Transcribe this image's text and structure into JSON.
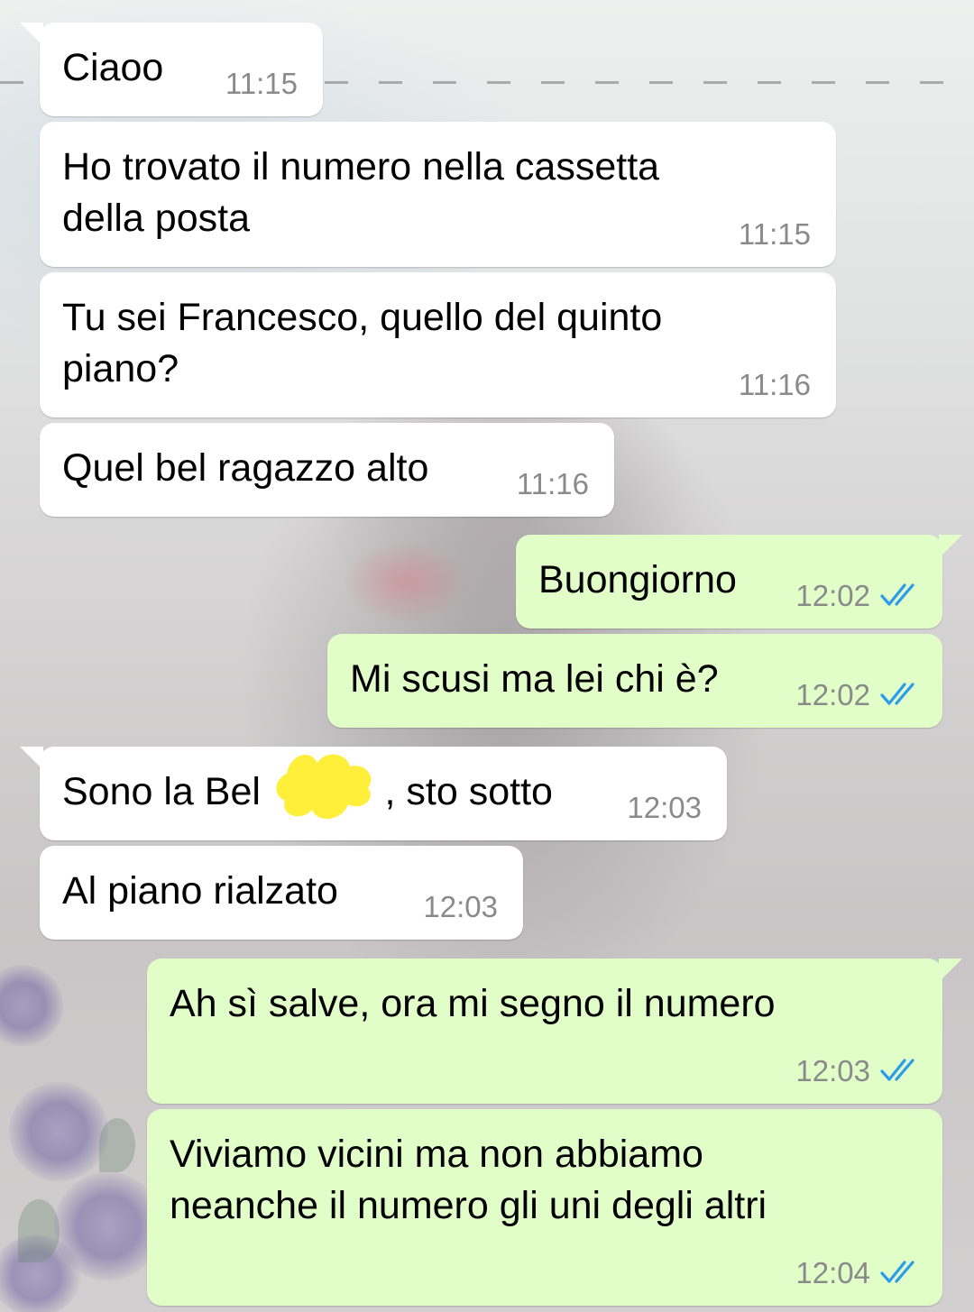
{
  "colors": {
    "incoming_bubble": "#ffffff",
    "outgoing_bubble": "#e1fec9",
    "timestamp": "#8a8a8a",
    "read_ticks": "#2b9bea",
    "redaction": "#ffef3a"
  },
  "messages": [
    {
      "direction": "in",
      "text": "Ciaoo",
      "time": "11:15"
    },
    {
      "direction": "in",
      "text": "Ho trovato il numero nella cassetta\ndella posta",
      "time": "11:15"
    },
    {
      "direction": "in",
      "text": "Tu sei Francesco, quello del quinto\npiano?",
      "time": "11:16"
    },
    {
      "direction": "in",
      "text": "Quel bel ragazzo alto",
      "time": "11:16"
    },
    {
      "direction": "out",
      "text": "Buongiorno",
      "time": "12:02",
      "status_icon": "double-check-read-icon"
    },
    {
      "direction": "out",
      "text": "Mi scusi ma lei chi è?",
      "time": "12:02",
      "status_icon": "double-check-read-icon"
    },
    {
      "direction": "in",
      "text": "Sono la Bel    , sto sotto",
      "time": "12:03",
      "note_redacted": true
    },
    {
      "direction": "in",
      "text": "Al piano rialzato",
      "time": "12:03"
    },
    {
      "direction": "out",
      "text": "Ah sì salve, ora mi segno il numero",
      "time": "12:03",
      "status_icon": "double-check-read-icon"
    },
    {
      "direction": "out",
      "text": "Viviamo vicini ma non abbiamo\nneanche il numero gli uni degli altri",
      "time": "12:04",
      "status_icon": "double-check-read-icon"
    }
  ]
}
